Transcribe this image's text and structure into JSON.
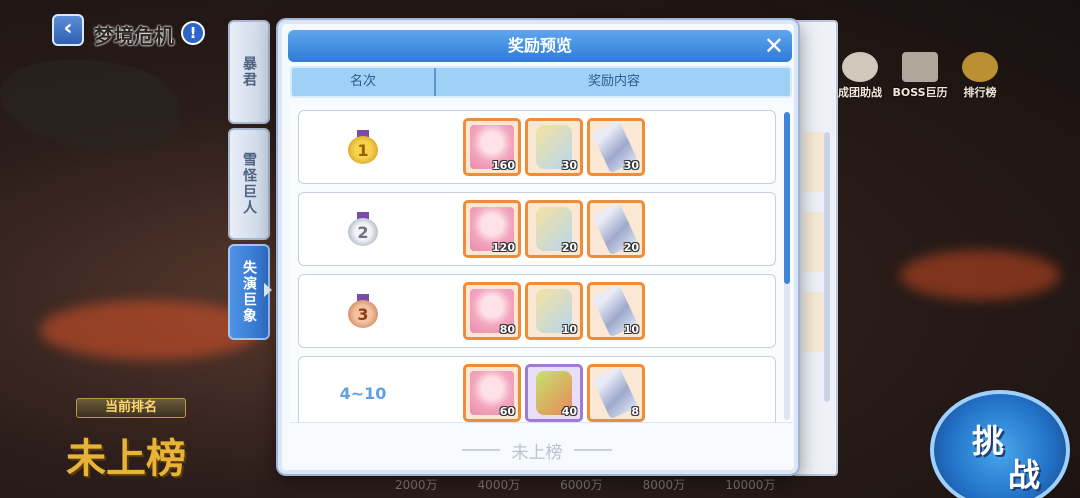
{
  "header": {
    "title": "梦境危机",
    "back_icon": "back-arrow-icon",
    "info_icon": "info-icon"
  },
  "side_tabs": [
    {
      "label": "暴君",
      "active": false
    },
    {
      "label": "雪怪巨人",
      "active": false
    },
    {
      "label": "失演巨象",
      "active": true
    }
  ],
  "right_icons": [
    "成团助战",
    "BOSS巨历",
    "排行榜"
  ],
  "current_rank": {
    "label": "当前排名",
    "value": "未上榜"
  },
  "progress_labels": [
    "2000万",
    "4000万",
    "6000万",
    "8000万",
    "10000万"
  ],
  "challenge": {
    "label_1": "挑",
    "label_2": "战"
  },
  "modal": {
    "title": "奖励预览",
    "close_label": "✕",
    "col_rank": "名次",
    "col_rewards": "奖励内容",
    "rows": [
      {
        "rank": "1",
        "medal": "gold",
        "items": [
          {
            "type": "char",
            "qty": "160"
          },
          {
            "type": "bag",
            "qty": "30"
          },
          {
            "type": "ticket",
            "qty": "30"
          }
        ]
      },
      {
        "rank": "2",
        "medal": "silver",
        "items": [
          {
            "type": "char",
            "qty": "120"
          },
          {
            "type": "bag",
            "qty": "20"
          },
          {
            "type": "ticket",
            "qty": "20"
          }
        ]
      },
      {
        "rank": "3",
        "medal": "bronze",
        "items": [
          {
            "type": "char",
            "qty": "80"
          },
          {
            "type": "bag",
            "qty": "10"
          },
          {
            "type": "ticket",
            "qty": "10"
          }
        ]
      },
      {
        "rank": "4~10",
        "medal": "",
        "items": [
          {
            "type": "char",
            "qty": "60"
          },
          {
            "type": "bag2",
            "qty": "40"
          },
          {
            "type": "ticket",
            "qty": "8"
          }
        ]
      }
    ],
    "my_rank": "未上榜"
  },
  "colors": {
    "accent": "#2f7bd6",
    "header_blue": "#5ea6ee",
    "rank_blue": "#5f9fe3"
  }
}
